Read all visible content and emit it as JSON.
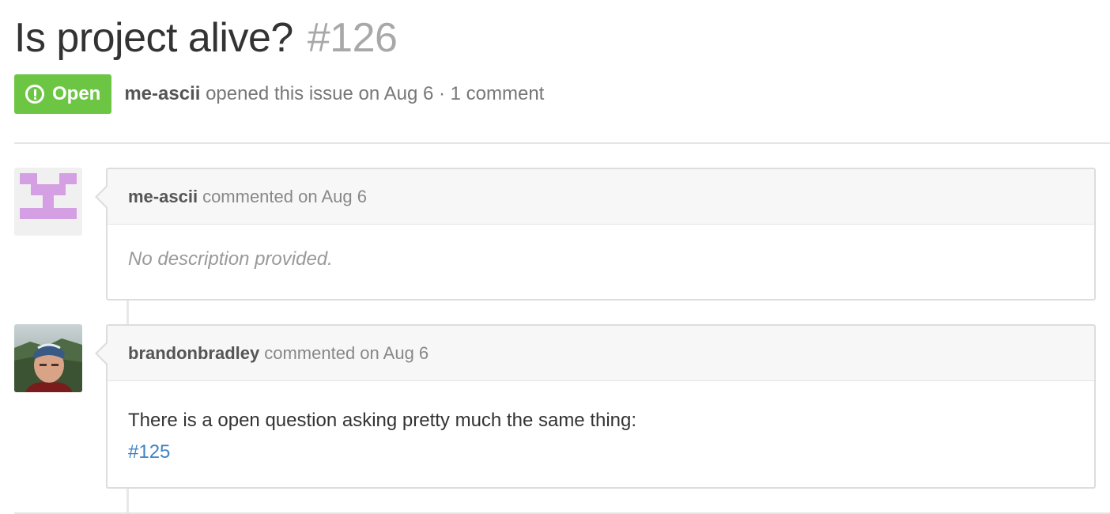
{
  "issue": {
    "title": "Is project alive?",
    "number": "#126",
    "state": "Open",
    "author": "me-ascii",
    "summary": "opened this issue on Aug 6 · 1 comment"
  },
  "colors": {
    "open_badge": "#6cc644",
    "link": "#4183c4",
    "identicon": "#d59fe3"
  },
  "comments": [
    {
      "author": "me-ascii",
      "meta": "commented on Aug 6",
      "body": "No description provided.",
      "avatar": "identicon"
    },
    {
      "author": "brandonbradley",
      "meta": "commented on Aug 6",
      "body": "There is a open question asking pretty much the same thing:",
      "link": "#125",
      "avatar": "photo"
    }
  ]
}
